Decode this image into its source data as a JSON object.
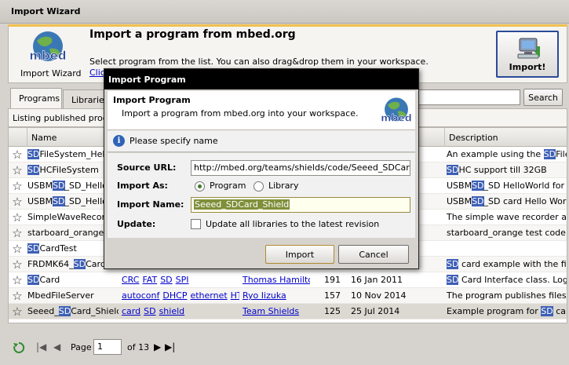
{
  "window": {
    "title": "Import Wizard"
  },
  "header": {
    "logo_label": "Import Wizard",
    "title": "Import a program from mbed.org",
    "description": "Select program from the list. You can also drag&drop them in your workspace.",
    "link_text": "Clic",
    "import_button": "Import!"
  },
  "tabs": [
    {
      "label": "Programs"
    },
    {
      "label": "Libraries"
    }
  ],
  "search": {
    "button": "Search",
    "value": ""
  },
  "listing": {
    "text": "Listing published program"
  },
  "table": {
    "columns": {
      "name": "Name",
      "description": "Description"
    },
    "rows": [
      {
        "pre": "",
        "hl": "SD",
        "post": "FileSystem_HelloW",
        "tags": [],
        "author": "",
        "imports": "",
        "date": "",
        "d_pre": "An example using the ",
        "d_hl": "SD",
        "d_post": "FileSy"
      },
      {
        "pre": "",
        "hl": "SD",
        "post": "HCFileSystem",
        "tags": [],
        "author": "",
        "imports": "",
        "date": "",
        "d_pre": "",
        "d_hl": "SD",
        "d_post": "HC support till 32GB"
      },
      {
        "pre": "USBM",
        "hl": "SD",
        "post": "_SD_HelloW",
        "tags": [],
        "author": "",
        "imports": "",
        "date": "",
        "d_pre": "USBM",
        "d_hl": "SD",
        "d_post": "_SD HelloWorld for FR"
      },
      {
        "pre": "USBM",
        "hl": "SD",
        "post": "_SD_HelloW",
        "tags": [],
        "author": "",
        "imports": "",
        "date": "",
        "d_pre": "USBM",
        "d_hl": "SD",
        "d_post": "_SD card Hello World f"
      },
      {
        "pre": "SimpleWaveRecorde",
        "hl": "",
        "post": "",
        "tags": [],
        "author": "",
        "imports": "",
        "date": "",
        "d_pre": "The simple wave recorder and ",
        "d_hl": "",
        "d_post": ""
      },
      {
        "pre": "starboard_orange_sa",
        "hl": "",
        "post": "",
        "tags": [],
        "author": "",
        "imports": "",
        "date": "",
        "d_pre": "starboard_orange test code for",
        "d_hl": "",
        "d_post": ""
      },
      {
        "pre": "",
        "hl": "SD",
        "post": "CardTest",
        "tags": [],
        "author": "",
        "imports": "",
        "date": "",
        "d_pre": "",
        "d_hl": "",
        "d_post": ""
      },
      {
        "pre": "FRDMK64_",
        "hl": "SD",
        "post": "Card",
        "tags": [],
        "author": "",
        "imports": "",
        "date": "",
        "d_pre": "",
        "d_hl": "SD",
        "d_post": " card example with the file sy"
      },
      {
        "pre": "",
        "hl": "SD",
        "post": "Card",
        "tags": [
          "CRC",
          "FAT",
          "SD",
          "SPI"
        ],
        "author": "Thomas Hamilton",
        "imports": "191",
        "date": "16 Jan 2011",
        "d_pre": "",
        "d_hl": "SD",
        "d_post": " Card Interface class. Log ra"
      },
      {
        "pre": "MbedFileServer",
        "hl": "",
        "post": "",
        "tags": [
          "autoconf",
          "DHCP",
          "ethernet",
          "HTTP"
        ],
        "author": "Ryo Iizuka",
        "imports": "157",
        "date": "10 Nov 2014",
        "d_pre": "The program publishes files at ",
        "d_hl": "",
        "d_post": ""
      },
      {
        "pre": "Seeed_",
        "hl": "SD",
        "post": "Card_Shield",
        "tags": [
          "card",
          "SD",
          "shield"
        ],
        "author": "Team Shields",
        "imports": "125",
        "date": "25 Jul 2014",
        "d_pre": "Example program for ",
        "d_hl": "SD",
        "d_post": " card s"
      }
    ]
  },
  "pager": {
    "page_label": "Page",
    "page_value": "1",
    "of_label": "of 13"
  },
  "dialog": {
    "title": "Import Program",
    "header_title": "Import Program",
    "header_desc": "Import a program from mbed.org into your workspace.",
    "info": "Please specify name",
    "source_url_label": "Source URL:",
    "source_url_value": "http://mbed.org/teams/shields/code/Seeed_SDCard_Shie",
    "import_as_label": "Import As:",
    "radio_program": "Program",
    "radio_library": "Library",
    "import_name_label": "Import Name:",
    "import_name_value": "Seeed_SDCard_Shield",
    "update_label": "Update:",
    "update_checkbox": "Update all libraries to the latest revision",
    "import_button": "Import",
    "cancel_button": "Cancel"
  },
  "colors": {
    "highlight": "#3d5fb5",
    "link": "#0000cc",
    "accent": "#f0c050"
  }
}
